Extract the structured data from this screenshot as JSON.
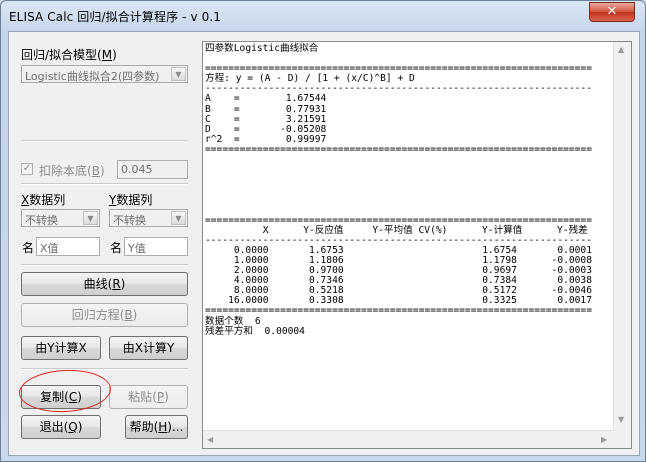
{
  "window": {
    "title": "ELISA Calc 回归/拟合计算程序 - v 0.1",
    "close_glyph": "✕"
  },
  "left_panel": {
    "model_label": "回归/拟合模型",
    "model_hotkey": "M",
    "model_value": "Logistic曲线拟合2(四参数)",
    "deduct_label": "扣除本底",
    "deduct_hotkey": "B",
    "deduct_checked": true,
    "deduct_value": "0.045",
    "x_col_label_hot": "X",
    "x_col_label_rest": "数据列",
    "y_col_label_hot": "Y",
    "y_col_label_rest": "数据列",
    "x_transform": "不转换",
    "y_transform": "不转换",
    "x_name_label": "名",
    "x_name_placeholder": "X值",
    "y_name_label": "名",
    "y_name_placeholder": "Y值",
    "curve_button": "曲线",
    "curve_hotkey": "R",
    "equation_button": "回归方程",
    "equation_hotkey": "B",
    "calc_from_y": "由Y计算X",
    "calc_from_x": "由X计算Y",
    "copy_button": "复制",
    "copy_hotkey": "C",
    "paste_button": "粘贴",
    "paste_hotkey": "P",
    "exit_button": "退出",
    "exit_hotkey": "Q",
    "help_button": "帮助",
    "help_hotkey": "H"
  },
  "output": {
    "lines": [
      "四参数Logistic曲线拟合",
      "",
      "===================================================================",
      "方程: y = (A - D) / [1 + (x/C)^B] + D",
      "-------------------------------------------------------------------",
      "A    =        1.67544",
      "B    =        0.77931",
      "C    =        3.21591",
      "D    =       -0.05208",
      "r^2  =        0.99997",
      "===================================================================",
      "",
      "",
      "",
      "",
      "",
      "",
      "===================================================================",
      "          X      Y-反应值     Y-平均值 CV(%)      Y-计算值      Y-残差",
      "-------------------------------------------------------------------",
      "     0.0000       1.6753                        1.6754       0.0001",
      "     1.0000       1.1806                        1.1798      -0.0008",
      "     2.0000       0.9700                        0.9697      -0.0003",
      "     4.0000       0.7346                        0.7384       0.0038",
      "     8.0000       0.5218                        0.5172      -0.0046",
      "    16.0000       0.3308                        0.3325       0.0017",
      "===================================================================",
      "数据个数  6",
      "残差平方和  0.00004"
    ]
  }
}
